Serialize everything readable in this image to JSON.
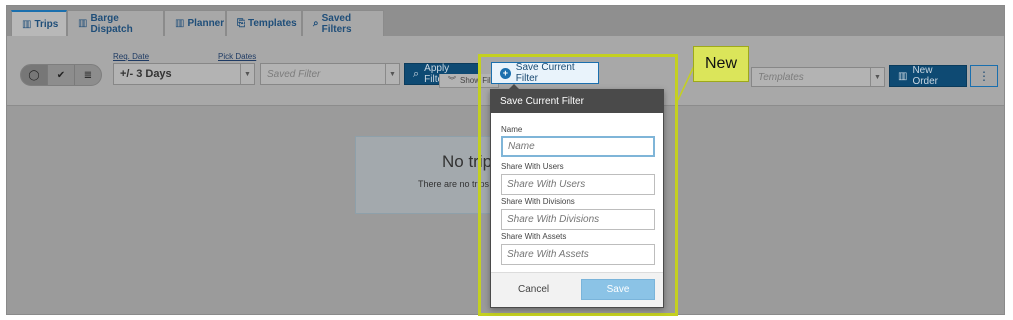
{
  "tabs": [
    {
      "label": "Trips",
      "icon": "grid-icon",
      "active": true
    },
    {
      "label": "Barge Dispatch",
      "icon": "grid-icon"
    },
    {
      "label": "Planner",
      "icon": "grid-icon"
    },
    {
      "label": "Templates",
      "icon": "template-icon"
    },
    {
      "label": "Saved Filters",
      "icon": "search-icon"
    }
  ],
  "filters": {
    "req_date_label": "Req. Date",
    "req_date_value": "+/- 3 Days",
    "pick_dates_label": "Pick Dates",
    "saved_filter_placeholder": "Saved Filter",
    "apply_filters": "Apply Filters",
    "templates_placeholder": "Templates",
    "new_order": "New Order",
    "more": "⋮",
    "show_filters": "Show Fil"
  },
  "empty_state": {
    "title": "No trip",
    "message": "There are no trips"
  },
  "save_filter_button": "Save Current Filter",
  "callout": "New",
  "dialog": {
    "title": "Save Current Filter",
    "name_label": "Name",
    "name_placeholder": "Name",
    "share_users_label": "Share With Users",
    "share_users_placeholder": "Share With Users",
    "share_divisions_label": "Share With Divisions",
    "share_divisions_placeholder": "Share With Divisions",
    "share_assets_label": "Share With Assets",
    "share_assets_placeholder": "Share With Assets",
    "cancel": "Cancel",
    "save": "Save"
  },
  "colors": {
    "accent_blue": "#1a6fae",
    "highlight": "#c4d020",
    "callout_bg": "#dbe55a"
  }
}
